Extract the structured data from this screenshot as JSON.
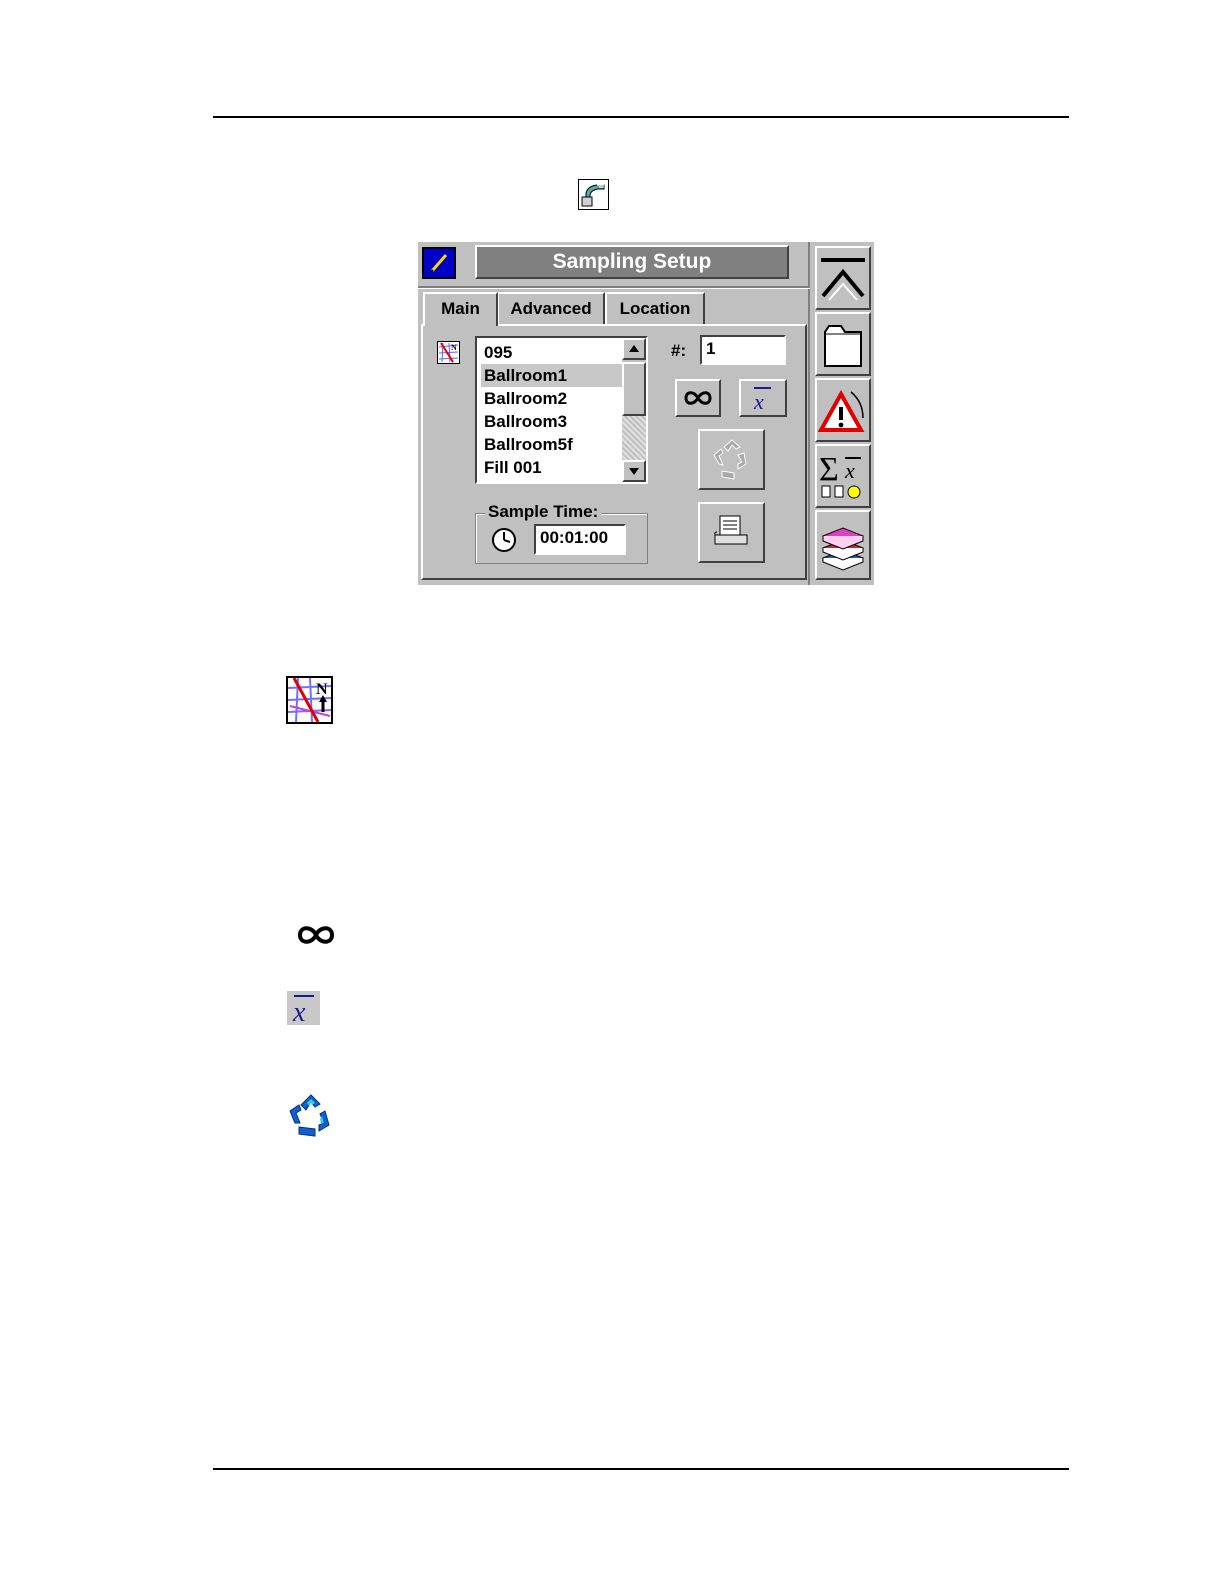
{
  "dialog": {
    "title": "Sampling Setup",
    "tabs": [
      {
        "label": "Main",
        "active": true
      },
      {
        "label": "Advanced",
        "active": false
      },
      {
        "label": "Location",
        "active": false
      }
    ],
    "locations": {
      "items": [
        "095",
        "Ballroom1",
        "Ballroom2",
        "Ballroom3",
        "Ballroom5f",
        "Fill 001"
      ],
      "selected": "Ballroom1"
    },
    "count": {
      "label": "#:",
      "value": "1"
    },
    "sample_time": {
      "label": "Sample Time:",
      "value": "00:01:00"
    },
    "buttons": {
      "continuous_icon": "infinity-icon",
      "average_icon": "x-bar-icon",
      "recycle_icon": "recycle-icon",
      "print_icon": "printer-icon"
    }
  },
  "sidebar": {
    "items": [
      "collapse-up-icon",
      "folder-icon",
      "alarm-warning-icon",
      "statistics-icon",
      "books-icon"
    ]
  },
  "colors": {
    "dialog_bg": "#c0c0c0",
    "title_bar": "#808080",
    "system_button": "#0000c8",
    "selection": "#c8c8c8"
  }
}
